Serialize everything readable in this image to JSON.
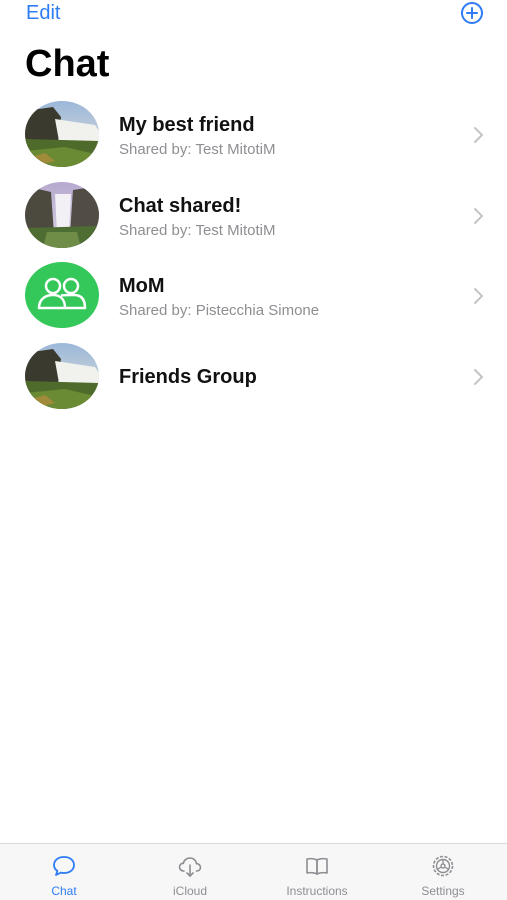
{
  "nav": {
    "edit_label": "Edit",
    "add_icon": "plus-circle-icon",
    "title": "Chat"
  },
  "accent_color": "#2e7cf6",
  "chats": [
    {
      "title": "My best friend",
      "subtitle": "Shared by: Test MitotiM",
      "avatar": "waterfall-photo"
    },
    {
      "title": "Chat shared!",
      "subtitle": "Shared by: Test MitotiM",
      "avatar": "waterfall-photo"
    },
    {
      "title": "MoM",
      "subtitle": "Shared by: Pistecchia Simone",
      "avatar": "group-icon",
      "avatar_color": "#34c759"
    },
    {
      "title": "Friends Group",
      "subtitle": "",
      "avatar": "waterfall-photo"
    }
  ],
  "tabs": [
    {
      "label": "Chat",
      "icon": "chat-bubble-icon",
      "active": true
    },
    {
      "label": "iCloud",
      "icon": "cloud-download-icon",
      "active": false
    },
    {
      "label": "Instructions",
      "icon": "book-icon",
      "active": false
    },
    {
      "label": "Settings",
      "icon": "gear-icon",
      "active": false
    }
  ]
}
